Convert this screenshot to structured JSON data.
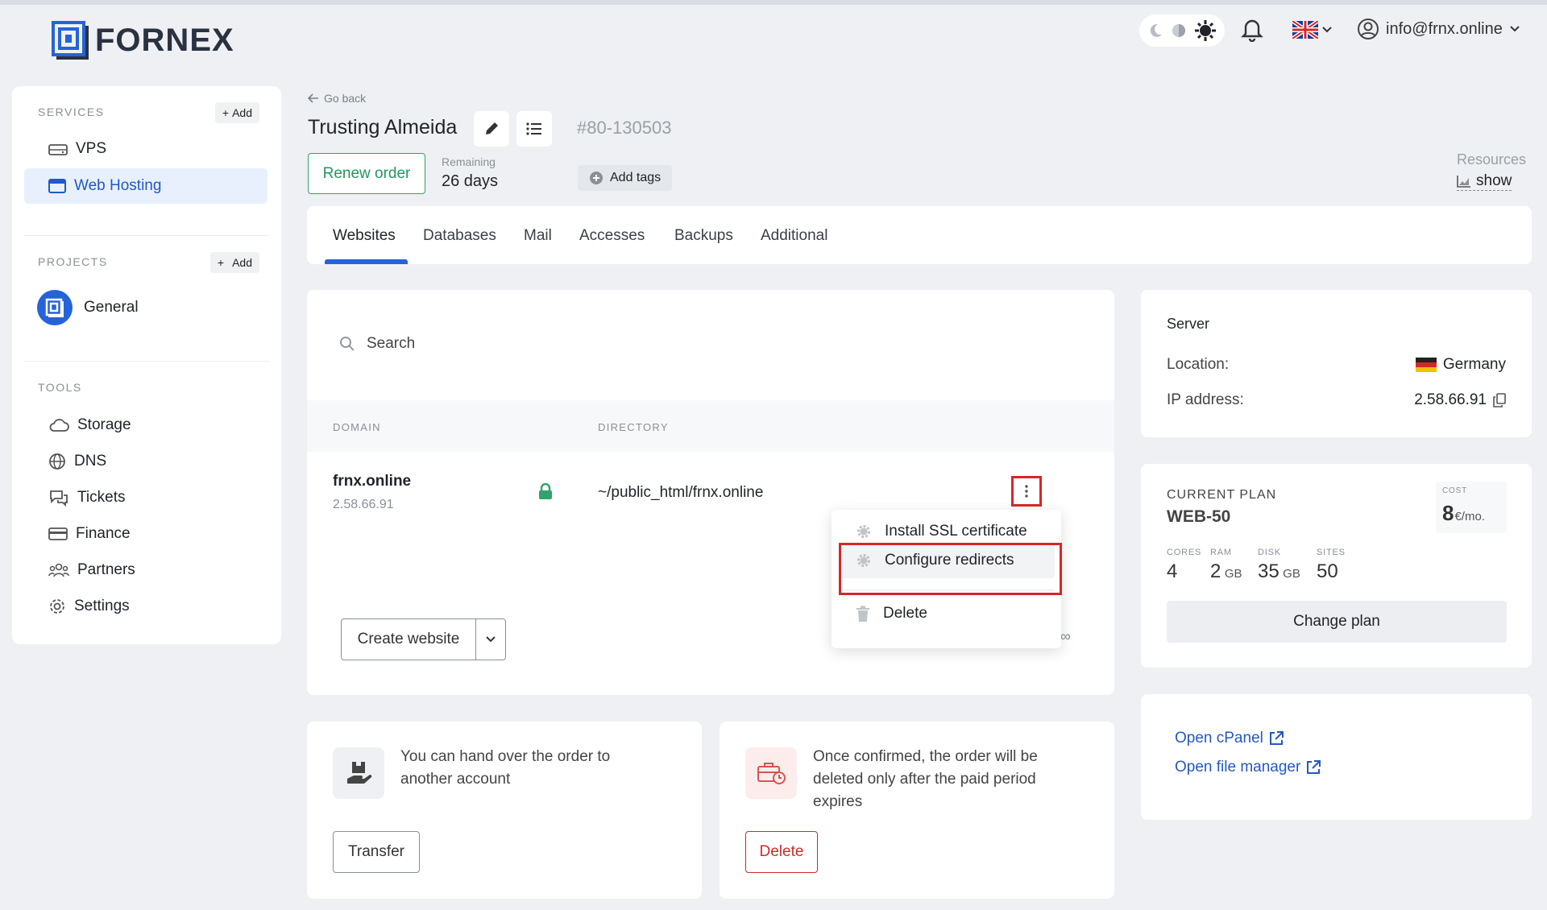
{
  "brand": {
    "name": "FORNEX"
  },
  "topbar": {
    "user_email": "info@frnx.online",
    "language": "EN"
  },
  "sidebar": {
    "services_heading": "SERVICES",
    "services_add": "Add",
    "services": [
      {
        "label": "VPS",
        "icon": "server-icon"
      },
      {
        "label": "Web Hosting",
        "icon": "browser-window-icon",
        "active": true
      }
    ],
    "projects_heading": "PROJECTS",
    "projects_add": "Add",
    "projects": [
      {
        "label": "General",
        "icon": "project-logo-icon"
      }
    ],
    "tools_heading": "TOOLS",
    "tools": [
      {
        "label": "Storage",
        "icon": "cloud-icon"
      },
      {
        "label": "DNS",
        "icon": "globe-icon"
      },
      {
        "label": "Tickets",
        "icon": "chat-bubbles-icon"
      },
      {
        "label": "Finance",
        "icon": "card-icon"
      },
      {
        "label": "Partners",
        "icon": "users-icon"
      },
      {
        "label": "Settings",
        "icon": "gear-icon"
      }
    ]
  },
  "header": {
    "go_back": "Go back",
    "order_name": "Trusting Almeida",
    "order_number": "80-130503",
    "renew_label": "Renew order",
    "remaining_label": "Remaining",
    "remaining_value": "26 days",
    "add_tags": "Add tags",
    "resources_label": "Resources",
    "resources_action": "show"
  },
  "tabs": [
    "Websites",
    "Databases",
    "Mail",
    "Accesses",
    "Backups",
    "Additional"
  ],
  "websites": {
    "search_placeholder": "Search",
    "col_domain": "DOMAIN",
    "col_directory": "DIRECTORY",
    "rows": [
      {
        "domain": "frnx.online",
        "ip": "2.58.66.91",
        "directory": "~/public_html/frnx.online"
      }
    ],
    "create_label": "Create website",
    "limit_symbol": "∞"
  },
  "context_menu": {
    "items": [
      {
        "label": "Install SSL certificate",
        "icon": "gear-icon"
      },
      {
        "label": "Configure redirects",
        "icon": "gear-icon",
        "highlighted": true
      },
      {
        "label": "Delete",
        "icon": "trash-icon"
      }
    ]
  },
  "transfer": {
    "text": "You can hand over the order to another account",
    "button": "Transfer"
  },
  "delete_card": {
    "text": "Once confirmed, the order will be deleted only after the paid period expires",
    "button": "Delete"
  },
  "server": {
    "title": "Server",
    "location_label": "Location:",
    "location_value": "Germany",
    "ip_label": "IP address:",
    "ip_value": "2.58.66.91"
  },
  "plan": {
    "heading": "CURRENT PLAN",
    "name": "WEB-50",
    "cost_label": "COST",
    "cost_value": "8",
    "cost_unit": "€/mo.",
    "specs": [
      {
        "label": "CORES",
        "value": "4",
        "unit": ""
      },
      {
        "label": "RAM",
        "value": "2",
        "unit": "GB"
      },
      {
        "label": "DISK",
        "value": "35",
        "unit": "GB"
      },
      {
        "label": "SITES",
        "value": "50",
        "unit": ""
      }
    ],
    "change_label": "Change plan"
  },
  "links": {
    "cpanel": "Open cPanel",
    "file_manager": "Open file manager"
  },
  "colors": {
    "accent": "#2563d8",
    "success": "#23965f",
    "danger": "#d42828"
  }
}
